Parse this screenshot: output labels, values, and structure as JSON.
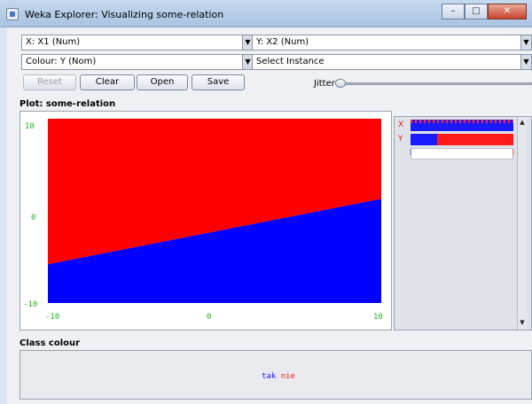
{
  "window": {
    "title": "Weka Explorer: Visualizing some-relation",
    "minimize_glyph": "–",
    "maximize_glyph": "□",
    "close_glyph": "✕"
  },
  "controls": {
    "x_axis": "X: X1 (Num)",
    "y_axis": "Y: X2 (Num)",
    "colour": "Colour: Y (Nom)",
    "select_instance": "Select Instance",
    "dropdown_glyph": "▼",
    "buttons": {
      "reset": "Reset",
      "clear": "Clear",
      "open": "Open",
      "save": "Save"
    },
    "jitter_label": "Jitter"
  },
  "plot": {
    "title": "Plot: some-relation",
    "y_ticks": {
      "top": "10",
      "mid": "0",
      "bottom": "-10"
    },
    "x_ticks": {
      "left": "-10",
      "mid": "0",
      "right": "10"
    }
  },
  "legend": {
    "x_letter": "X",
    "y_letter": "Y",
    "scroll_up": "▲",
    "scroll_down": "▼"
  },
  "class_colour": {
    "title": "Class colour",
    "classes": [
      {
        "name": "tak",
        "color": "#1a1aff"
      },
      {
        "name": "nie",
        "color": "#ff1a1a"
      }
    ]
  },
  "colors": {
    "class_tak": "#0000ff",
    "class_nie": "#ff0000",
    "axis": "#1db31d"
  },
  "chart_data": {
    "type": "scatter",
    "xlim": [
      -10,
      10
    ],
    "ylim": [
      -10,
      10
    ],
    "xticks": [
      -10,
      0,
      10
    ],
    "yticks": [
      -10,
      0,
      10
    ],
    "decision_boundary": {
      "x": [
        -10,
        10
      ],
      "y": [
        -5.8,
        1.3
      ]
    },
    "regions": [
      {
        "name": "tak",
        "side": "below boundary",
        "color": "#0000ff"
      },
      {
        "name": "nie",
        "side": "above boundary",
        "color": "#ff0000"
      }
    ]
  }
}
